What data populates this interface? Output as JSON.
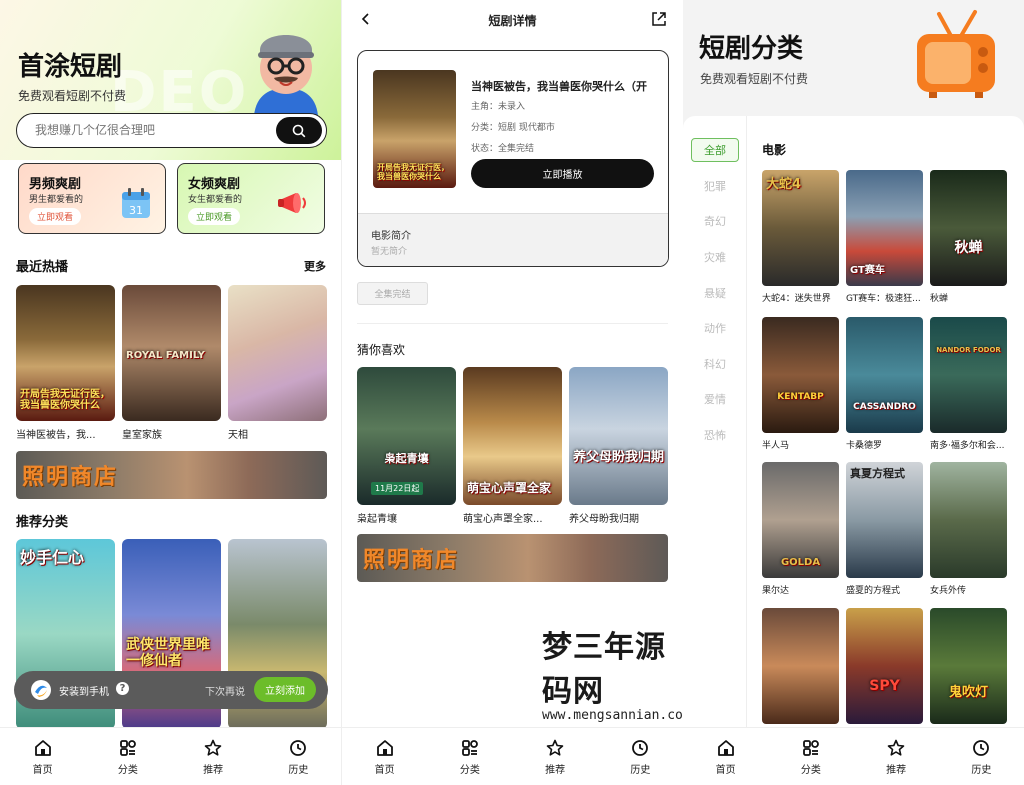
{
  "home": {
    "title": "首涂短剧",
    "subtitle": "免费观看短剧不付费",
    "watermark": "DEO",
    "search_placeholder": "我想赚几个亿很合理吧",
    "cat_male": {
      "title": "男频爽剧",
      "sub": "男生都爱看的",
      "btn": "立即观看"
    },
    "cat_female": {
      "title": "女频爽剧",
      "sub": "女生都爱看的",
      "btn": "立即观看"
    },
    "recent_title": "最近热播",
    "more": "更多",
    "recent": [
      {
        "name": "当神医被告，我...",
        "poster_text": "开局告我无证行医，我当兽医你哭什么"
      },
      {
        "name": "皇室家族",
        "poster_text": "ROYAL FAMILY"
      },
      {
        "name": "天相",
        "poster_text": ""
      }
    ],
    "banner_text": "照明商店",
    "recommend_title": "推荐分类",
    "recommend": [
      {
        "poster_text": "妙手仁心"
      },
      {
        "poster_text": "武侠世界里唯一修仙者"
      },
      {
        "poster_text": ""
      }
    ],
    "install": {
      "text": "安装到手机",
      "later": "下次再说",
      "add": "立刻添加"
    }
  },
  "detail": {
    "header": "短剧详情",
    "title": "当神医被告，我当兽医你哭什么（开",
    "poster_text": "开局告我无证行医，我当兽医你哭什么",
    "cast": "主角：未录入",
    "category": "分类：短剧  现代都市",
    "status": "状态：全集完结",
    "play": "立即播放",
    "intro_title": "电影简介",
    "intro_text": "暂无简介",
    "episode_btn": "全集完结",
    "guess_title": "猜你喜欢",
    "guess": [
      {
        "name": "枭起青壤",
        "poster_text": "枭起青壤",
        "date": "11月22日起"
      },
      {
        "name": "萌宝心声罩全家...",
        "poster_text": "萌宝心声罩全家"
      },
      {
        "name": "养父母盼我归期",
        "poster_text": "养父母盼我归期"
      }
    ],
    "banner_text": "照明商店",
    "watermark_cn": "梦三年源码网",
    "watermark_url": "www.mengsannian.com"
  },
  "category": {
    "title": "短剧分类",
    "subtitle": "免费观看短剧不付费",
    "side": [
      "全部",
      "犯罪",
      "奇幻",
      "灾难",
      "悬疑",
      "动作",
      "科幻",
      "爱情",
      "恐怖"
    ],
    "section": "电影",
    "movies": [
      {
        "name": "大蛇4：迷失世界",
        "poster_text": "大蛇4"
      },
      {
        "name": "GT赛车：极速狂...",
        "poster_text": "GT赛车"
      },
      {
        "name": "秋蝉",
        "poster_text": "秋蝉"
      },
      {
        "name": "半人马",
        "poster_text": "KENTABP"
      },
      {
        "name": "卡桑德罗",
        "poster_text": "CASSANDRO"
      },
      {
        "name": "南多·福多尔和会...",
        "poster_text": "NANDOR FODOR"
      },
      {
        "name": "果尔达",
        "poster_text": "GOLDA"
      },
      {
        "name": "盛夏的方程式",
        "poster_text": "真夏方程式"
      },
      {
        "name": "女兵外传",
        "poster_text": ""
      },
      {
        "name": "",
        "poster_text": ""
      },
      {
        "name": "",
        "poster_text": "SPY"
      },
      {
        "name": "",
        "poster_text": "鬼吹灯"
      }
    ]
  },
  "tabs": [
    "首页",
    "分类",
    "推荐",
    "历史"
  ],
  "colors": {
    "accent_green": "#6cbd2a",
    "dark": "#111111",
    "banner_text": "#f1882a"
  }
}
